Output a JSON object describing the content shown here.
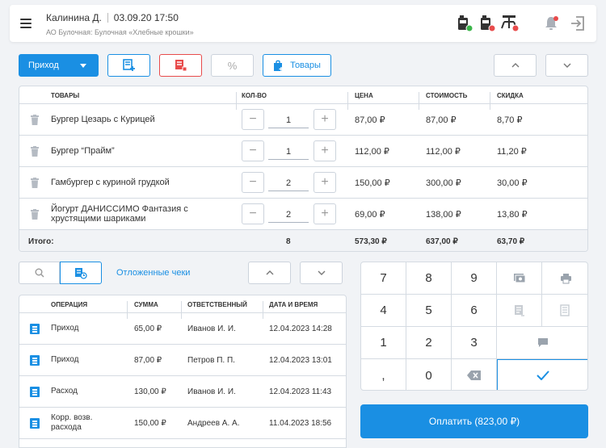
{
  "header": {
    "user": "Калинина Д.",
    "datetime": "03.09.20 17:50",
    "org": "АО Булочная: Булочная «Хлебные крошки»"
  },
  "colors": {
    "accent": "#1a8fe3",
    "danger": "#e84b4b",
    "ok": "#3bb54a",
    "badge": "#e84b4b"
  },
  "toolbar": {
    "operation_type": "Приход",
    "goods_label": "Товары"
  },
  "goods_table": {
    "headers": [
      "ТОВАРЫ",
      "КОЛ-ВО",
      "ЦЕНА",
      "СТОИМОСТЬ",
      "СКИДКА"
    ],
    "rows": [
      {
        "name": "Бургер Цезарь с Курицей",
        "qty": "1",
        "price": "87,00 ₽",
        "cost": "87,00 ₽",
        "discount": "8,70 ₽"
      },
      {
        "name": "Бургер “Прайм”",
        "qty": "1",
        "price": "112,00 ₽",
        "cost": "112,00 ₽",
        "discount": "11,20 ₽"
      },
      {
        "name": "Гамбургер с куриной грудкой",
        "qty": "2",
        "price": "150,00 ₽",
        "cost": "300,00 ₽",
        "discount": "30,00 ₽"
      },
      {
        "name": "Йогурт ДАНИССИМО Фантазия с хрустящими шариками",
        "qty": "2",
        "price": "69,00 ₽",
        "cost": "138,00 ₽",
        "discount": "13,80 ₽"
      }
    ],
    "total": {
      "label": "Итого:",
      "qty": "8",
      "price": "573,30 ₽",
      "cost": "637,00 ₽",
      "discount": "63,70 ₽"
    }
  },
  "deferred": {
    "label": "Отложенные чеки"
  },
  "ops_table": {
    "headers": [
      "ОПЕРАЦИЯ",
      "СУММА",
      "ОТВЕТСТВЕННЫЙ",
      "ДАТА И ВРЕМЯ"
    ],
    "rows": [
      {
        "op": "Приход",
        "sum": "65,00 ₽",
        "resp": "Иванов И. И.",
        "date": "12.04.2023 14:28"
      },
      {
        "op": "Приход",
        "sum": "87,00 ₽",
        "resp": "Петров П. П.",
        "date": "12.04.2023 13:01"
      },
      {
        "op": "Расход",
        "sum": "130,00 ₽",
        "resp": "Иванов И. И.",
        "date": "12.04.2023 11:43"
      },
      {
        "op": "Корр. возв. расхода",
        "sum": "150,00 ₽",
        "resp": "Андреев А. А.",
        "date": "11.04.2023 18:56"
      }
    ]
  },
  "numpad": {
    "keys": [
      "7",
      "8",
      "9",
      "4",
      "5",
      "6",
      "1",
      "2",
      "3",
      ",",
      "0"
    ]
  },
  "pay": {
    "label": "Оплатить (823,00 ₽)"
  }
}
